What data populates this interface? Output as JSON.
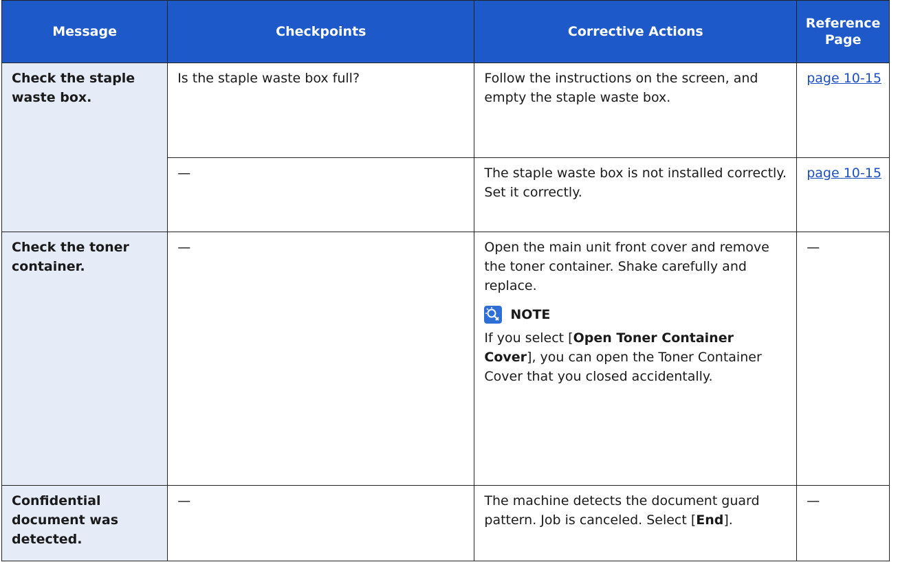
{
  "headers": {
    "message": "Message",
    "checkpoints": "Checkpoints",
    "corrective": "Corrective Actions",
    "reference_line1": "Reference",
    "reference_line2": "Page"
  },
  "rows": [
    {
      "message": "Check the staple waste box.",
      "checkpoint": "Is the staple waste box full?",
      "action": "Follow the instructions on the screen, and empty the staple waste box.",
      "reference": "page 10-15"
    },
    {
      "checkpoint": "—",
      "action": "The staple waste box is not installed correctly. Set it correctly.",
      "reference": "page 10-15"
    },
    {
      "message": "Check the toner container.",
      "checkpoint": "—",
      "action": "Open the main unit front cover and remove the toner container. Shake carefully and replace.",
      "note": {
        "label": "NOTE",
        "icon": "note-lightbulb-icon",
        "text_before": "If you select [",
        "bold": "Open Toner Container Cover",
        "text_after": "], you can open the Toner Container Cover that you closed accidentally."
      },
      "reference": "—"
    },
    {
      "message": "Confidential document was detected.",
      "checkpoint": "—",
      "action_before": "The machine detects the document guard pattern. Job is canceled. Select [",
      "action_bold": "End",
      "action_after": "].",
      "reference": "—"
    }
  ],
  "colors": {
    "header_bg": "#1d59c9",
    "message_bg": "#e5ebf7",
    "link": "#1d4fc2"
  }
}
